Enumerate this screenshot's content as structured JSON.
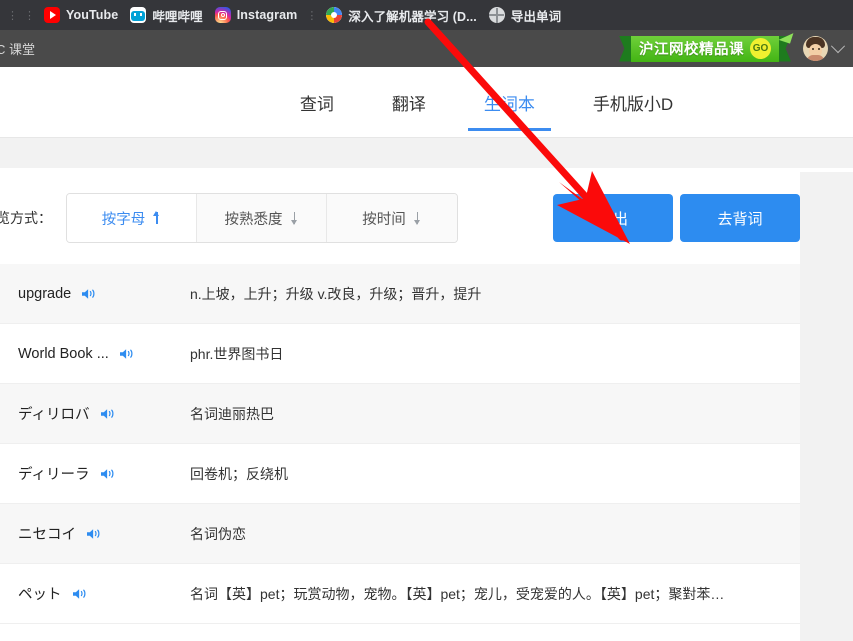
{
  "browser": {
    "bookmarks": [
      {
        "label": "YouTube",
        "icon": "youtube-icon"
      },
      {
        "label": "哔哩哔哩",
        "icon": "bilibili-icon"
      },
      {
        "label": "Instagram",
        "icon": "instagram-icon"
      },
      {
        "label": "深入了解机器学习 (D...",
        "icon": "colorwheel-icon"
      },
      {
        "label": "导出单词",
        "icon": "globe-icon"
      }
    ]
  },
  "header": {
    "site_title": "C 课堂",
    "promo": {
      "text": "沪江网校精品课",
      "go_label": "GO"
    },
    "account": {
      "avatar_alt": "user-avatar",
      "chevron": "chevron-down-icon"
    }
  },
  "nav": {
    "tabs": [
      {
        "label": "查词",
        "active": false
      },
      {
        "label": "翻译",
        "active": false
      },
      {
        "label": "生词本",
        "active": true
      },
      {
        "label": "手机版小D",
        "active": false
      }
    ]
  },
  "toolbar": {
    "sort_label": "览方式：",
    "sort_options": [
      {
        "label": "按字母",
        "direction": "up",
        "active": true
      },
      {
        "label": "按熟悉度",
        "direction": "down",
        "active": false
      },
      {
        "label": "按时间",
        "direction": "down",
        "active": false
      }
    ],
    "export_label": "导出",
    "review_label": "去背词"
  },
  "word_list": {
    "rows": [
      {
        "word": "upgrade",
        "definition": "n.上坡，上升；升级 v.改良，升级；晋升，提升"
      },
      {
        "word": "World Book ...",
        "definition": "phr.世界图书日"
      },
      {
        "word": "ディリロバ",
        "definition": "名词迪丽热巴"
      },
      {
        "word": "ディリーラ",
        "definition": "回卷机；反绕机"
      },
      {
        "word": "ニセコイ",
        "definition": "名词伪恋"
      },
      {
        "word": "ペット",
        "definition": "名词【英】pet；玩赏动物，宠物。【英】pet；宠儿，受宠爱的人。【英】pet；聚對苯…"
      }
    ]
  },
  "annotation": {
    "arrow_color": "#fb0a0a"
  },
  "colors": {
    "accent_blue": "#2d8cf0",
    "tab_active": "#3c8cf0",
    "bookmark_bar_bg": "#35363a",
    "site_header_bg": "#4a4a4a",
    "page_bg": "#f2f2f2",
    "row_alt_bg": "#f7f7f7"
  }
}
